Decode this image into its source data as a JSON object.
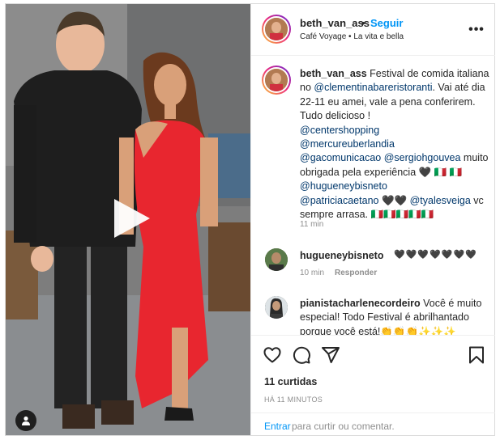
{
  "post": {
    "username": "beth_van_ass",
    "separator": "•",
    "follow_label": "Seguir",
    "location": "Café Voyage • La vita e bella",
    "more_icon": "more-horizontal-icon"
  },
  "caption": {
    "username": "beth_van_ass",
    "text_1": "Festival de comida italiana no",
    "mention_1": "@clementinabareristoranti",
    "text_2": ". Vai até dia 22-11 eu amei, vale a pena conferirem. Tudo delicioso !",
    "mention_2": "@centershopping",
    "mention_3": "@mercureuberlandia",
    "mention_4": "@gacomunicacao",
    "mention_5": "@sergiohgouvea",
    "text_3": "muito obrigada pela experiência 🖤",
    "text_4": "🇮🇹 🇮🇹",
    "mention_6": "@hugueneybisneto",
    "mention_7": "@patriciacaetano",
    "text_5": "🖤🖤",
    "mention_8": "@tyalesveiga",
    "text_6": "vc sempre arrasa.",
    "text_7": "🇮🇹🇮🇹🇮🇹🇮🇹🇮🇹",
    "time": "11 min"
  },
  "comments": [
    {
      "username": "hugueneybisneto",
      "text": "🖤🖤🖤🖤🖤🖤🖤",
      "time": "10 min",
      "reply_label": "Responder"
    },
    {
      "username": "pianistacharlenecordeiro",
      "text": "Você é muito especial! Todo Festival é abrilhantado porque você está!👏👏👏✨✨✨"
    }
  ],
  "actions": {
    "like_icon": "heart-icon",
    "comment_icon": "comment-icon",
    "share_icon": "share-icon",
    "save_icon": "bookmark-icon",
    "likes_label": "11 curtidas",
    "time_ago": "HÁ 11 MINUTOS"
  },
  "login": {
    "enter_label": "Entrar",
    "rest_label": "para curtir ou comentar."
  },
  "colors": {
    "link": "#0095f6",
    "mention": "#00376b",
    "muted": "#8e8e8e",
    "dress": "#e8262f"
  }
}
